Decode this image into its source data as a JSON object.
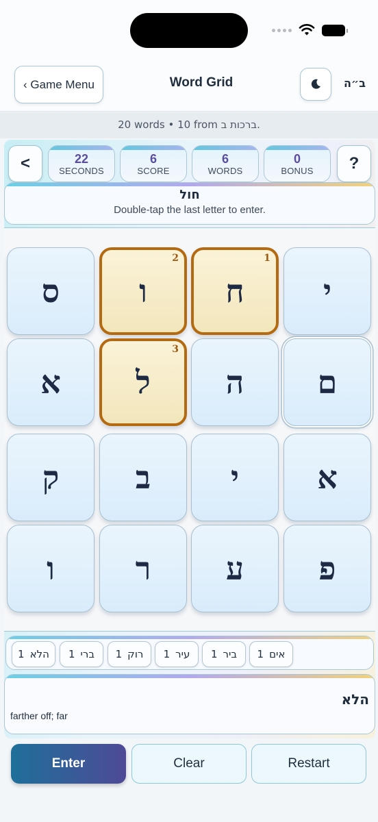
{
  "header": {
    "menu_label": "‹ Game Menu",
    "title": "Word Grid",
    "bh_label": "ב״ה"
  },
  "subtitle": "20 words • 10 from ברכות ב.",
  "stats": {
    "prev_label": "<",
    "help_label": "?",
    "items": [
      {
        "value": "22",
        "label": "SECONDS"
      },
      {
        "value": "6",
        "label": "SCORE"
      },
      {
        "value": "6",
        "label": "WORDS"
      },
      {
        "value": "0",
        "label": "BONUS"
      }
    ]
  },
  "current": {
    "word": "חול",
    "hint": "Double-tap the last letter to enter."
  },
  "grid": [
    [
      {
        "letter": "ס"
      },
      {
        "letter": "ו",
        "order": "2"
      },
      {
        "letter": "ח",
        "order": "1"
      },
      {
        "letter": "י"
      }
    ],
    [
      {
        "letter": "א"
      },
      {
        "letter": "ל",
        "order": "3"
      },
      {
        "letter": "ה"
      },
      {
        "letter": "ם"
      }
    ],
    [
      {
        "letter": "ק"
      },
      {
        "letter": "ב"
      },
      {
        "letter": "י"
      },
      {
        "letter": "א"
      }
    ],
    [
      {
        "letter": "ו"
      },
      {
        "letter": "ר"
      },
      {
        "letter": "ע"
      },
      {
        "letter": "פ"
      }
    ]
  ],
  "found_words": [
    {
      "word": "הלא",
      "count": "1"
    },
    {
      "word": "ברי",
      "count": "1"
    },
    {
      "word": "רוק",
      "count": "1"
    },
    {
      "word": "עיר",
      "count": "1"
    },
    {
      "word": "ביר",
      "count": "1"
    },
    {
      "word": "אים",
      "count": "1"
    }
  ],
  "definition": {
    "word": "הלא",
    "text": "farther off; far"
  },
  "actions": {
    "enter": "Enter",
    "clear": "Clear",
    "restart": "Restart"
  },
  "colors": {
    "accent": "#5a4d9e",
    "selected_border": "#b36a11",
    "primary_button_start": "#1f6f9a",
    "primary_button_end": "#4e4a96"
  }
}
